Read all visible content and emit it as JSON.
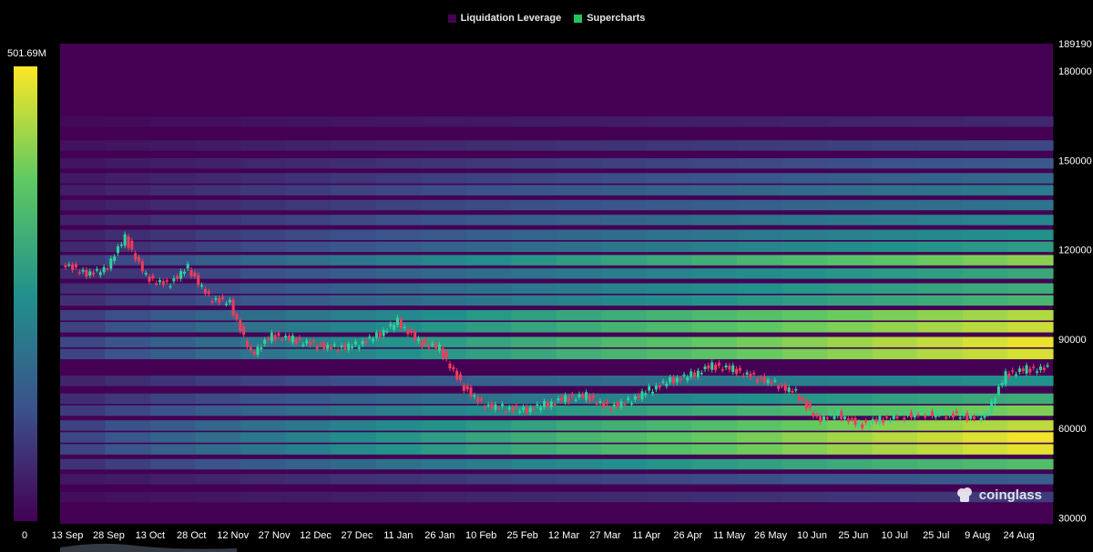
{
  "legend": [
    {
      "label": "Liquidation Leverage",
      "color": "#440154"
    },
    {
      "label": "Supercharts",
      "color": "#22c55e"
    }
  ],
  "colorbar": {
    "max_label": "501.69M",
    "min_label": "0"
  },
  "watermark": "coinglass",
  "chart_data": {
    "type": "heatmap",
    "title": "",
    "y_axis": {
      "ticks": [
        "30000",
        "60000",
        "90000",
        "120000",
        "150000",
        "180000",
        "189190"
      ],
      "max": 189190,
      "min": 28000
    },
    "x_axis": {
      "ticks": [
        "13 Sep",
        "28 Sep",
        "13 Oct",
        "28 Oct",
        "12 Nov",
        "27 Nov",
        "12 Dec",
        "27 Dec",
        "11 Jan",
        "26 Jan",
        "10 Feb",
        "25 Feb",
        "12 Mar",
        "27 Mar",
        "11 Apr",
        "26 Apr",
        "11 May",
        "26 May",
        "10 Jun",
        "25 Jun",
        "10 Jul",
        "25 Jul",
        "9 Aug",
        "24 Aug"
      ]
    },
    "colorscale": [
      "#440154",
      "#3b528b",
      "#21918c",
      "#5ec962",
      "#fde725"
    ],
    "colorscale_range": [
      0,
      501690000
    ],
    "price_series": [
      {
        "date": "13 Sep",
        "price": 116000
      },
      {
        "date": "20 Sep",
        "price": 112000
      },
      {
        "date": "28 Sep",
        "price": 113000
      },
      {
        "date": "6 Oct",
        "price": 124000
      },
      {
        "date": "13 Oct",
        "price": 111000
      },
      {
        "date": "20 Oct",
        "price": 108000
      },
      {
        "date": "28 Oct",
        "price": 114000
      },
      {
        "date": "4 Nov",
        "price": 104000
      },
      {
        "date": "12 Nov",
        "price": 102000
      },
      {
        "date": "20 Nov",
        "price": 85000
      },
      {
        "date": "27 Nov",
        "price": 91000
      },
      {
        "date": "5 Dec",
        "price": 90000
      },
      {
        "date": "12 Dec",
        "price": 88000
      },
      {
        "date": "20 Dec",
        "price": 87000
      },
      {
        "date": "27 Dec",
        "price": 88000
      },
      {
        "date": "4 Jan",
        "price": 91000
      },
      {
        "date": "11 Jan",
        "price": 96000
      },
      {
        "date": "19 Jan",
        "price": 89000
      },
      {
        "date": "26 Jan",
        "price": 87000
      },
      {
        "date": "3 Feb",
        "price": 75000
      },
      {
        "date": "10 Feb",
        "price": 68000
      },
      {
        "date": "18 Feb",
        "price": 67000
      },
      {
        "date": "25 Feb",
        "price": 66000
      },
      {
        "date": "5 Mar",
        "price": 68000
      },
      {
        "date": "12 Mar",
        "price": 70000
      },
      {
        "date": "20 Mar",
        "price": 71000
      },
      {
        "date": "27 Mar",
        "price": 67000
      },
      {
        "date": "4 Apr",
        "price": 69000
      },
      {
        "date": "11 Apr",
        "price": 73000
      },
      {
        "date": "19 Apr",
        "price": 76000
      },
      {
        "date": "26 Apr",
        "price": 78000
      },
      {
        "date": "4 May",
        "price": 81000
      },
      {
        "date": "11 May",
        "price": 80000
      },
      {
        "date": "19 May",
        "price": 77000
      },
      {
        "date": "26 May",
        "price": 75000
      },
      {
        "date": "3 Jun",
        "price": 72000
      },
      {
        "date": "10 Jun",
        "price": 63000
      },
      {
        "date": "18 Jun",
        "price": 65000
      },
      {
        "date": "25 Jun",
        "price": 61000
      },
      {
        "date": "3 Jul",
        "price": 63000
      },
      {
        "date": "10 Jul",
        "price": 64000
      },
      {
        "date": "18 Jul",
        "price": 65000
      },
      {
        "date": "25 Jul",
        "price": 65000
      },
      {
        "date": "2 Aug",
        "price": 64000
      },
      {
        "date": "9 Aug",
        "price": 64000
      },
      {
        "date": "16 Aug",
        "price": 78000
      },
      {
        "date": "24 Aug",
        "price": 80000
      },
      {
        "date": "1 Sep",
        "price": 80000
      }
    ],
    "bands": [
      {
        "price": 163000,
        "intensity": 0.12
      },
      {
        "price": 155000,
        "intensity": 0.22
      },
      {
        "price": 149000,
        "intensity": 0.28
      },
      {
        "price": 144000,
        "intensity": 0.34
      },
      {
        "price": 140000,
        "intensity": 0.42
      },
      {
        "price": 135000,
        "intensity": 0.38
      },
      {
        "price": 130000,
        "intensity": 0.46
      },
      {
        "price": 125000,
        "intensity": 0.5
      },
      {
        "price": 121000,
        "intensity": 0.55
      },
      {
        "price": 116500,
        "intensity": 0.82
      },
      {
        "price": 112000,
        "intensity": 0.6
      },
      {
        "price": 107000,
        "intensity": 0.62
      },
      {
        "price": 103000,
        "intensity": 0.66
      },
      {
        "price": 98000,
        "intensity": 0.88
      },
      {
        "price": 94000,
        "intensity": 0.92
      },
      {
        "price": 89000,
        "intensity": 0.97
      },
      {
        "price": 85000,
        "intensity": 0.94
      },
      {
        "price": 76000,
        "intensity": 0.5
      },
      {
        "price": 70000,
        "intensity": 0.62
      },
      {
        "price": 66000,
        "intensity": 0.8
      },
      {
        "price": 61000,
        "intensity": 0.9
      },
      {
        "price": 57000,
        "intensity": 0.98
      },
      {
        "price": 53000,
        "intensity": 0.96
      },
      {
        "price": 48000,
        "intensity": 0.7
      },
      {
        "price": 43000,
        "intensity": 0.3
      },
      {
        "price": 37000,
        "intensity": 0.18
      }
    ]
  }
}
